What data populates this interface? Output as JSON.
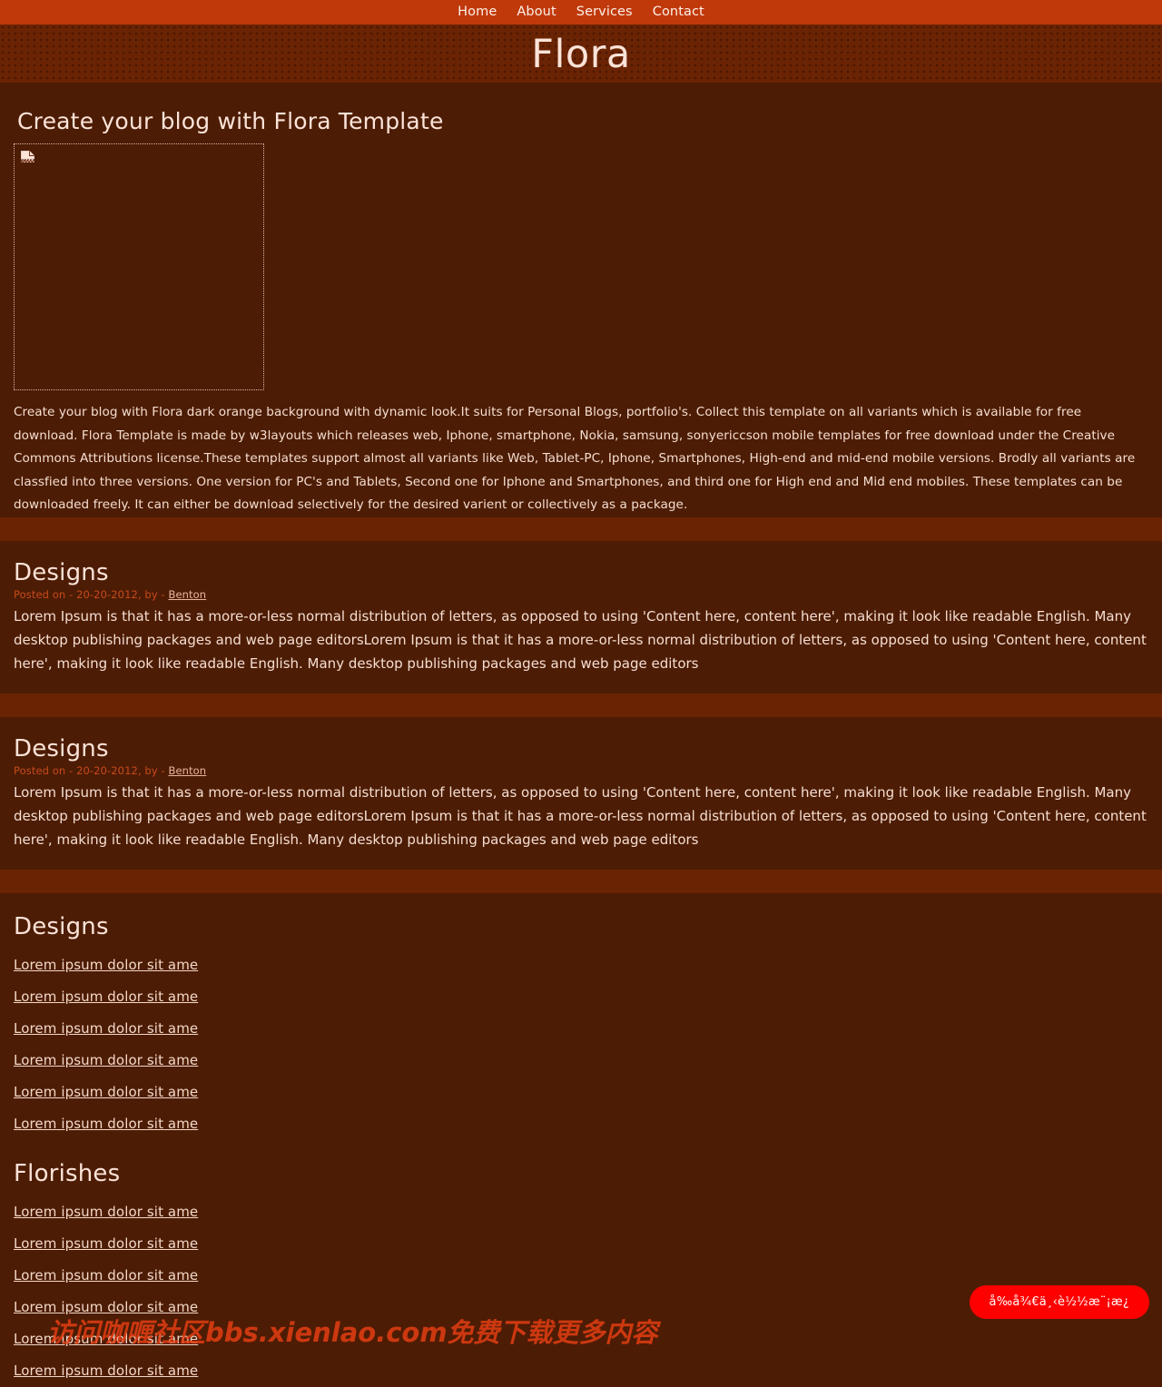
{
  "nav": {
    "items": [
      {
        "label": "Home"
      },
      {
        "label": "About"
      },
      {
        "label": "Services"
      },
      {
        "label": "Contact"
      }
    ]
  },
  "header": {
    "site_title": "Flora"
  },
  "main": {
    "page_heading": "Create your blog with Flora Template",
    "image_placeholder": {
      "icon": "broken-image-icon",
      "alt": ""
    },
    "intro_text": "Create your blog with Flora dark orange background with dynamic look.It suits for Personal Blogs, portfolio's. Collect this template on all variants which is available for free download. Flora Template is made by w3layouts which releases web, Iphone, smartphone, Nokia, samsung, sonyericcson mobile templates for free download under the Creative Commons Attributions license.These templates support almost all variants like Web, Tablet-PC, Iphone, Smartphones, High-end and mid-end mobile versions. Brodly all variants are classfied into three versions. One version for PC's and Tablets, Second one for Iphone and Smartphones, and third one for High end and Mid end mobiles. These templates can be downloaded freely. It can either be download selectively for the desired varient or collectively as a package."
  },
  "articles": [
    {
      "title": "Designs",
      "meta_prefix": "Posted on - 20-20-2012, by - ",
      "author": "Benton",
      "body": "Lorem Ipsum is that it has a more-or-less normal distribution of letters, as opposed to using 'Content here, content here', making it look like readable English. Many desktop publishing packages and web page editorsLorem Ipsum is that it has a more-or-less normal distribution of letters, as opposed to using 'Content here, content here', making it look like readable English. Many desktop publishing packages and web page editors"
    },
    {
      "title": "Designs",
      "meta_prefix": "Posted on - 20-20-2012, by - ",
      "author": "Benton",
      "body": "Lorem Ipsum is that it has a more-or-less normal distribution of letters, as opposed to using 'Content here, content here', making it look like readable English. Many desktop publishing packages and web page editorsLorem Ipsum is that it has a more-or-less normal distribution of letters, as opposed to using 'Content here, content here', making it look like readable English. Many desktop publishing packages and web page editors"
    }
  ],
  "link_sections": [
    {
      "title": "Designs",
      "links": [
        {
          "label": "Lorem ipsum dolor sit ame"
        },
        {
          "label": "Lorem ipsum dolor sit ame"
        },
        {
          "label": "Lorem ipsum dolor sit ame"
        },
        {
          "label": "Lorem ipsum dolor sit ame"
        },
        {
          "label": "Lorem ipsum dolor sit ame"
        },
        {
          "label": "Lorem ipsum dolor sit ame"
        }
      ]
    },
    {
      "title": "Florishes",
      "links": [
        {
          "label": "Lorem ipsum dolor sit ame"
        },
        {
          "label": "Lorem ipsum dolor sit ame"
        },
        {
          "label": "Lorem ipsum dolor sit ame"
        },
        {
          "label": "Lorem ipsum dolor sit ame"
        },
        {
          "label": "Lorem ipsum dolor sit ame"
        },
        {
          "label": "Lorem ipsum dolor sit ame"
        }
      ]
    }
  ],
  "float_button": {
    "label": "å‰å¾€ä¸‹è½½æ¨¡æ¿"
  },
  "watermark": {
    "text": "访问咖喱社区bbs.xienlao.com免费下载更多内容"
  },
  "colors": {
    "nav_bg": "#c0390b",
    "header_bg": "#6a2303",
    "page_bg": "#4d1c04",
    "band_bg": "#6a2303",
    "text": "#f5ded1",
    "heading": "#fbe3d8",
    "meta": "#c74a1c",
    "link": "#f3d8c8",
    "float_button_bg": "#ff0000",
    "watermark": "#e83e14"
  }
}
